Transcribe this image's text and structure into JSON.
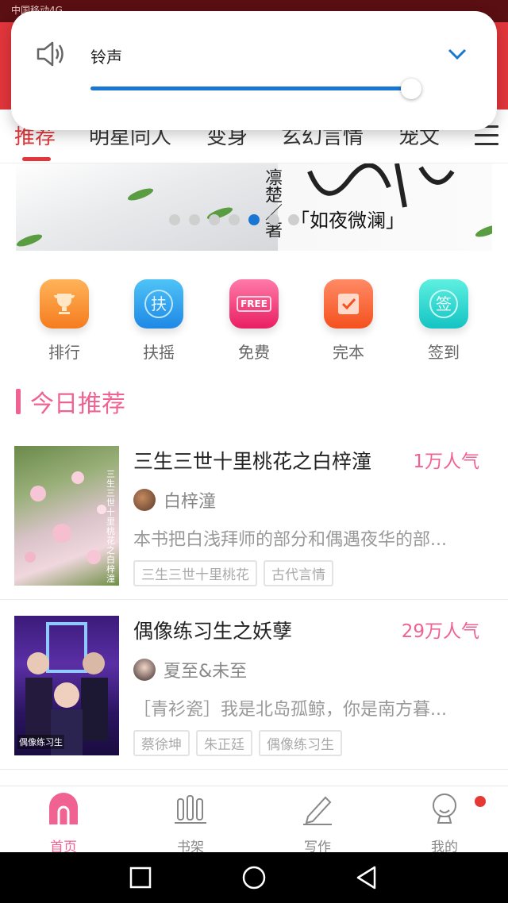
{
  "status_bar": {
    "carrier": "中国移动4G"
  },
  "tabs": [
    {
      "label": "推荐",
      "active": true
    },
    {
      "label": "明星同人",
      "active": false
    },
    {
      "label": "变身",
      "active": false
    },
    {
      "label": "玄幻言情",
      "active": false
    },
    {
      "label": "宠文",
      "active": false
    }
  ],
  "banner": {
    "author_vertical": "凛楚／著",
    "title": "「如夜微澜」",
    "page_count": 7,
    "active_page": 4
  },
  "quick_nav": [
    {
      "label": "排行",
      "icon": "trophy-icon",
      "color_from": "#ffb35a",
      "color_to": "#f57c1f"
    },
    {
      "label": "扶摇",
      "icon": "fuyao-icon",
      "glyph": "扶",
      "color_from": "#4fc3f7",
      "color_to": "#1e88e5"
    },
    {
      "label": "免费",
      "icon": "free-icon",
      "glyph": "FREE",
      "color_from": "#ff7aa8",
      "color_to": "#e91e63"
    },
    {
      "label": "完本",
      "icon": "complete-icon",
      "color_from": "#ff8a65",
      "color_to": "#f4511e"
    },
    {
      "label": "签到",
      "icon": "checkin-icon",
      "glyph": "签",
      "color_from": "#5ef0e0",
      "color_to": "#14c3c3"
    }
  ],
  "section": {
    "title": "今日推荐"
  },
  "books": [
    {
      "title": "三生三世十里桃花之白梓潼",
      "popularity": "1万人气",
      "author": "白梓潼",
      "description": "本书把白浅拜师的部分和偶遇夜华的部...",
      "tags": [
        "三生三世十里桃花",
        "古代言情"
      ],
      "cover_text": "三生三世十里桃花之白梓潼"
    },
    {
      "title": "偶像练习生之妖孽",
      "popularity": "29万人气",
      "author": "夏至&未至",
      "description": "［青衫瓷］我是北岛孤鲸，你是南方暮...",
      "tags": [
        "蔡徐坤",
        "朱正廷",
        "偶像练习生"
      ],
      "cover_text": "偶像练习生"
    }
  ],
  "bottom_nav": [
    {
      "label": "首页",
      "active": true
    },
    {
      "label": "书架",
      "active": false
    },
    {
      "label": "写作",
      "active": false
    },
    {
      "label": "我的",
      "active": false,
      "badge": true
    }
  ],
  "volume": {
    "label": "铃声",
    "level_percent": 100
  },
  "colors": {
    "accent_red": "#e1363b",
    "accent_pink": "#f06292",
    "slider_blue": "#1976d2"
  }
}
